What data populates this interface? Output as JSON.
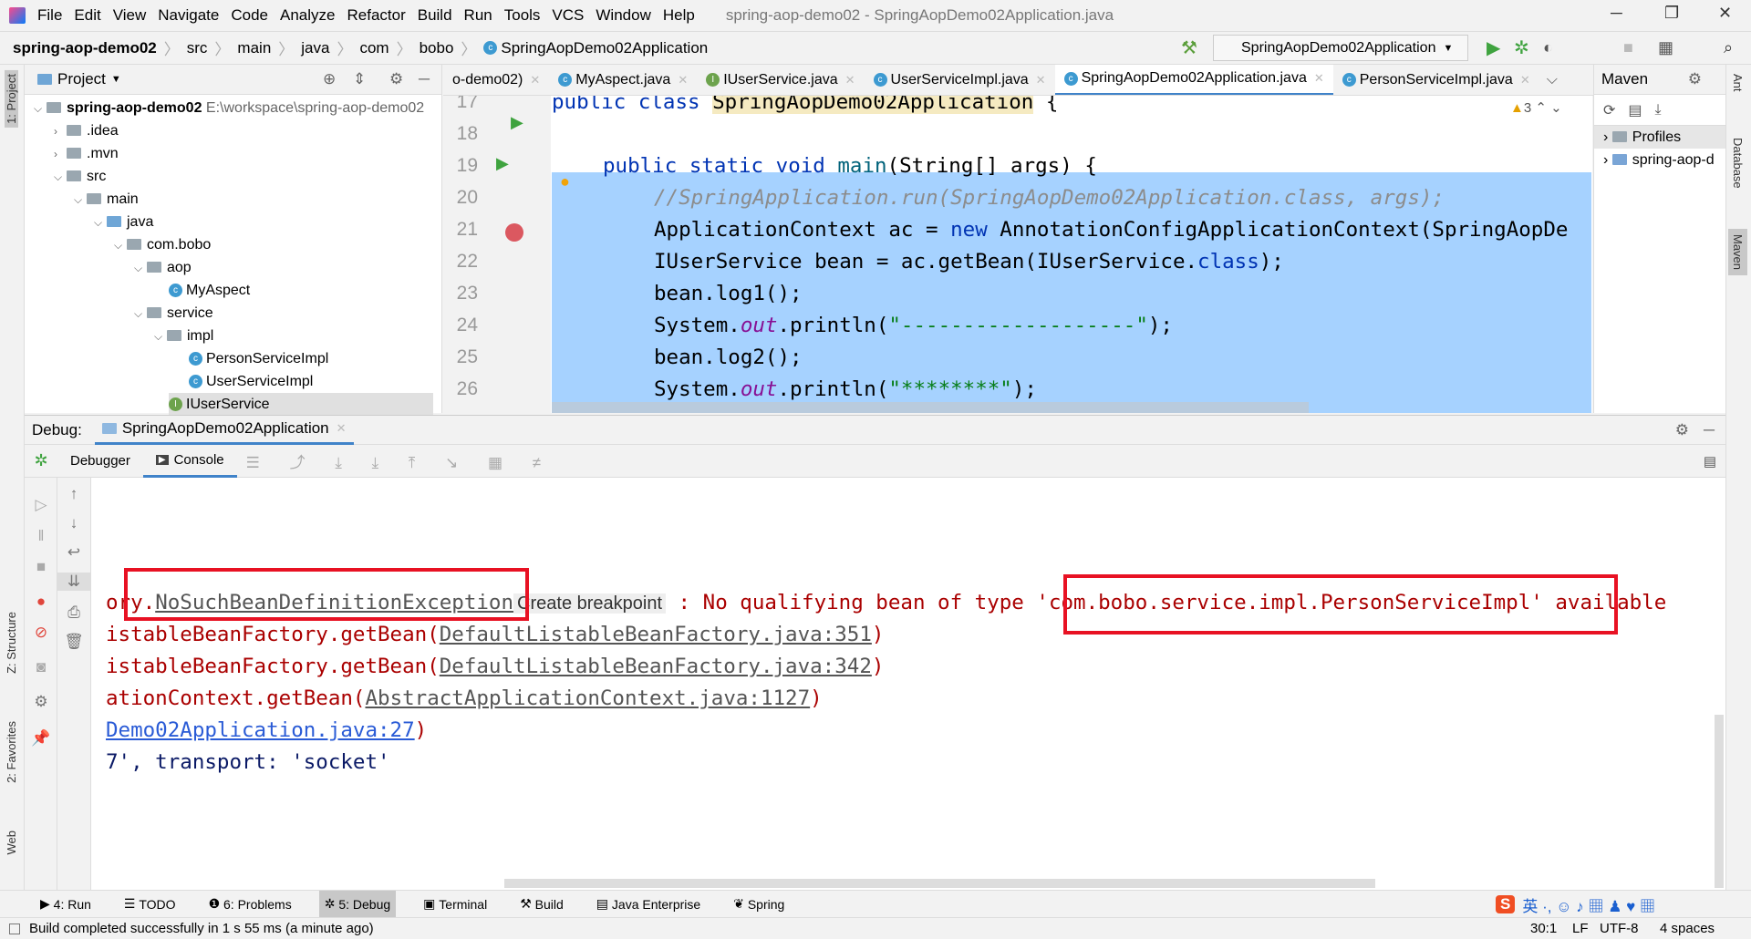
{
  "window": {
    "title": "spring-aop-demo02 - SpringAopDemo02Application.java"
  },
  "menu": [
    "File",
    "Edit",
    "View",
    "Navigate",
    "Code",
    "Analyze",
    "Refactor",
    "Build",
    "Run",
    "Tools",
    "VCS",
    "Window",
    "Help"
  ],
  "breadcrumb": [
    "spring-aop-demo02",
    "src",
    "main",
    "java",
    "com",
    "bobo",
    "SpringAopDemo02Application"
  ],
  "run_config": "SpringAopDemo02Application",
  "project": {
    "header": "Project",
    "root": "spring-aop-demo02",
    "root_path": "E:\\workspace\\spring-aop-demo02",
    "items": [
      ".idea",
      ".mvn",
      "src",
      "main",
      "java",
      "com.bobo",
      "aop",
      "MyAspect",
      "service",
      "impl",
      "PersonServiceImpl",
      "UserServiceImpl",
      "IUserService"
    ]
  },
  "tabs": [
    "o-demo02)",
    "MyAspect.java",
    "IUserService.java",
    "UserServiceImpl.java",
    "SpringAopDemo02Application.java",
    "PersonServiceImpl.java"
  ],
  "editor": {
    "warnings": "3",
    "lines": [
      {
        "n": "17",
        "t": "public class SpringAopDemo02Application {"
      },
      {
        "n": "18",
        "t": ""
      },
      {
        "n": "19",
        "t": "public static void main(String[] args) {"
      },
      {
        "n": "20",
        "t": "//SpringApplication.run(SpringAopDemo02Application.class, args);"
      },
      {
        "n": "21",
        "t": "ApplicationContext ac = new AnnotationConfigApplicationContext(SpringAopDe"
      },
      {
        "n": "22",
        "t": "IUserService bean = ac.getBean(IUserService.class);"
      },
      {
        "n": "23",
        "t": "bean.log1();"
      },
      {
        "n": "24",
        "t": "System.out.println(\"-------------------\");"
      },
      {
        "n": "25",
        "t": "bean.log2();"
      },
      {
        "n": "26",
        "t": "System.out.println(\"********\");"
      }
    ]
  },
  "maven": {
    "title": "Maven",
    "items": [
      "Profiles",
      "spring-aop-d"
    ]
  },
  "side_tabs": {
    "left": [
      "1: Project",
      "Z: Structure",
      "2: Favorites",
      "Web"
    ],
    "right": [
      "Ant",
      "Database",
      "Maven"
    ]
  },
  "debug": {
    "label": "Debug:",
    "session": "SpringAopDemo02Application",
    "tabs": [
      "Debugger",
      "Console"
    ]
  },
  "console": {
    "l1a": "ory.",
    "l1b": "NoSuchBeanDefinitionException",
    "l1c": "Create breakpoint",
    "l1d": " : No qualifying bean of type ",
    "l1e": "'com.bobo.service.impl.PersonServiceImpl'",
    "l1f": " available",
    "l2a": "istableBeanFactory.getBean(",
    "l2b": "DefaultListableBeanFactory.java:351",
    "l2c": ")",
    "l3a": "istableBeanFactory.getBean(",
    "l3b": "DefaultListableBeanFactory.java:342",
    "l3c": ")",
    "l4a": "ationContext.getBean(",
    "l4b": "AbstractApplicationContext.java:1127",
    "l4c": ")",
    "l5b": "Demo02Application.java:27",
    "l5c": ")",
    "l6": "7', transport: 'socket'"
  },
  "bottom_tabs": [
    "4: Run",
    "TODO",
    "6: Problems",
    "5: Debug",
    "Terminal",
    "Build",
    "Java Enterprise",
    "Spring"
  ],
  "status": {
    "message": "Build completed successfully in 1 s 55 ms (a minute ago)",
    "position": "30:1",
    "line_sep": "LF",
    "encoding": "UTF-8",
    "indent": "4 spaces"
  },
  "colors": {
    "selection": "#a6d2ff",
    "highlight_box": "#e81123",
    "error_text": "#aa0000"
  }
}
